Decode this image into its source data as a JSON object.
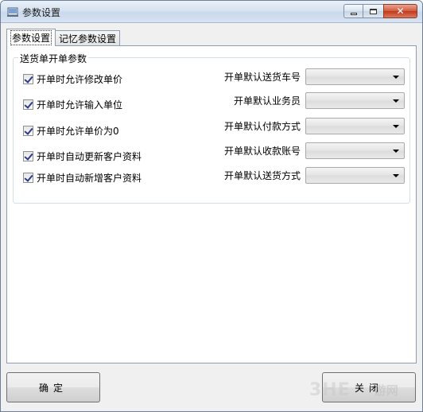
{
  "window": {
    "title": "参数设置"
  },
  "tabs": [
    {
      "label": "参数设置",
      "active": true
    },
    {
      "label": "记忆参数设置",
      "active": false
    }
  ],
  "group": {
    "legend": "送货单开单参数",
    "checkboxes": [
      {
        "label": "开单时允许修改单价",
        "checked": true
      },
      {
        "label": "开单时允许输入单位",
        "checked": true
      },
      {
        "label": "开单时允许单价为0",
        "checked": true
      },
      {
        "label": "开单时自动更新客户资料",
        "checked": true
      },
      {
        "label": "开单时自动新增客户资料",
        "checked": true
      }
    ],
    "combos": [
      {
        "label": "开单默认送货车号",
        "value": ""
      },
      {
        "label": "开单默认业务员",
        "value": ""
      },
      {
        "label": "开单默认付款方式",
        "value": ""
      },
      {
        "label": "开单默认收款账号",
        "value": ""
      },
      {
        "label": "开单默认送货方式",
        "value": ""
      }
    ]
  },
  "buttons": {
    "ok": "确定",
    "close": "关闭"
  },
  "watermark": {
    "logo": "3HE",
    "text": "游网"
  },
  "colors": {
    "titlebar": "#d7e3f1",
    "close_button": "#c2381b",
    "check_mark": "#2a3a8c"
  }
}
